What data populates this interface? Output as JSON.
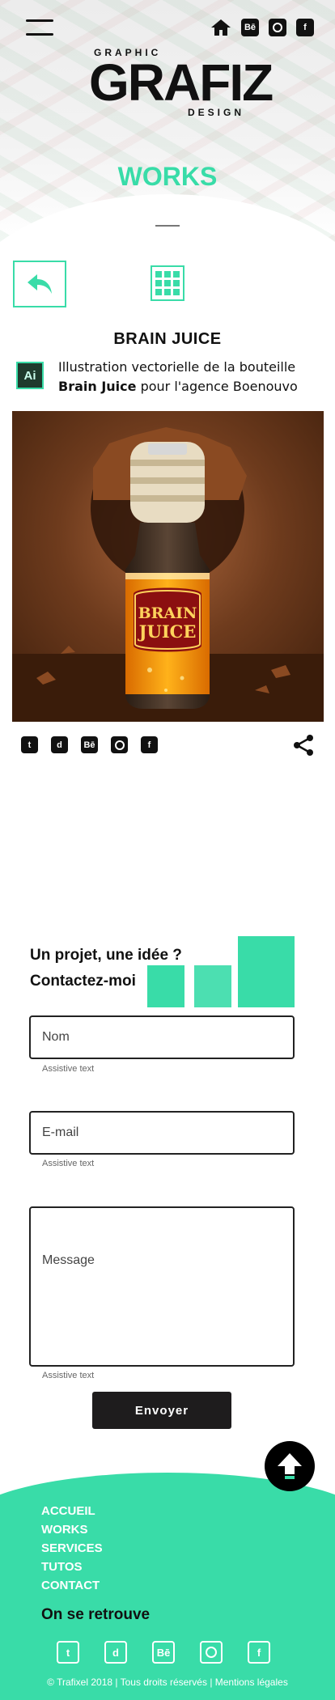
{
  "header": {
    "logo_top": "GRAPHIC",
    "logo_main": "GRAFIZ",
    "logo_bottom": "DESIGN",
    "icons": [
      "menu-icon",
      "home-icon",
      "behance-icon",
      "dribbble-icon",
      "facebook-icon"
    ],
    "behance_glyph": "Bē",
    "facebook_glyph": "f"
  },
  "section": {
    "title": "WORKS"
  },
  "project": {
    "title": "BRAIN JUICE",
    "tool_badge": "Ai",
    "description_prefix": "Illustration vectorielle de la bouteille ",
    "description_bold": "Brain Juice",
    "description_suffix": " pour l'agence Boenouvo",
    "label_line1": "BRAIN",
    "label_line2": "JUICE",
    "share_icons": [
      "tumblr-icon",
      "delicious-icon",
      "behance-icon",
      "dribbble-icon",
      "facebook-icon"
    ],
    "share_glyphs": {
      "tumblr": "t",
      "delicious": "d",
      "behance": "Bē",
      "facebook": "f"
    }
  },
  "contact": {
    "title_line1": "Un projet, une idée ?",
    "title_line2": "Contactez-moi",
    "name_placeholder": "Nom",
    "email_placeholder": "E-mail",
    "message_placeholder": "Message",
    "assistive": "Assistive text",
    "send_label": "Envoyer"
  },
  "footer": {
    "nav": [
      "ACCUEIL",
      "WORKS",
      "SERVICES",
      "TUTOS",
      "CONTACT"
    ],
    "follow_title": "On se retrouve",
    "copyright": "© Trafixel 2018 | Tous droits réservés | Mentions légales"
  },
  "colors": {
    "accent": "#39dca8",
    "dark": "#1e1c1d"
  }
}
